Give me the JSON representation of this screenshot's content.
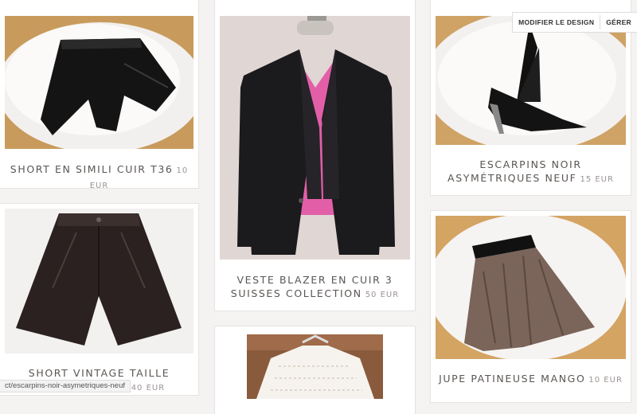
{
  "topbar": {
    "modify_design": "MODIFIER LE DESIGN",
    "manage": "GÉRER"
  },
  "products": [
    {
      "name": "SHORT EN SIMILI CUIR T36",
      "price": "10 EUR"
    },
    {
      "name": "VESTE BLAZER EN CUIR 3 SUISSES COLLECTION",
      "price": "50 EUR"
    },
    {
      "name": "ESCARPINS NOIR ASYMÉTRIQUES NEUF",
      "price": "15 EUR"
    },
    {
      "name": "SHORT VINTAGE TAILLE HAUTE EN CUIR",
      "price": "40 EUR"
    },
    {
      "name": "JUPE PATINEUSE MANGO",
      "price": "10 EUR"
    }
  ],
  "status_url": "ct/escarpins-noir-asymetriques-neuf",
  "colors": {
    "page_bg": "#f4f3f2",
    "card_bg": "#ffffff",
    "caption_text": "#5a5653",
    "price_text": "#9a9592"
  }
}
